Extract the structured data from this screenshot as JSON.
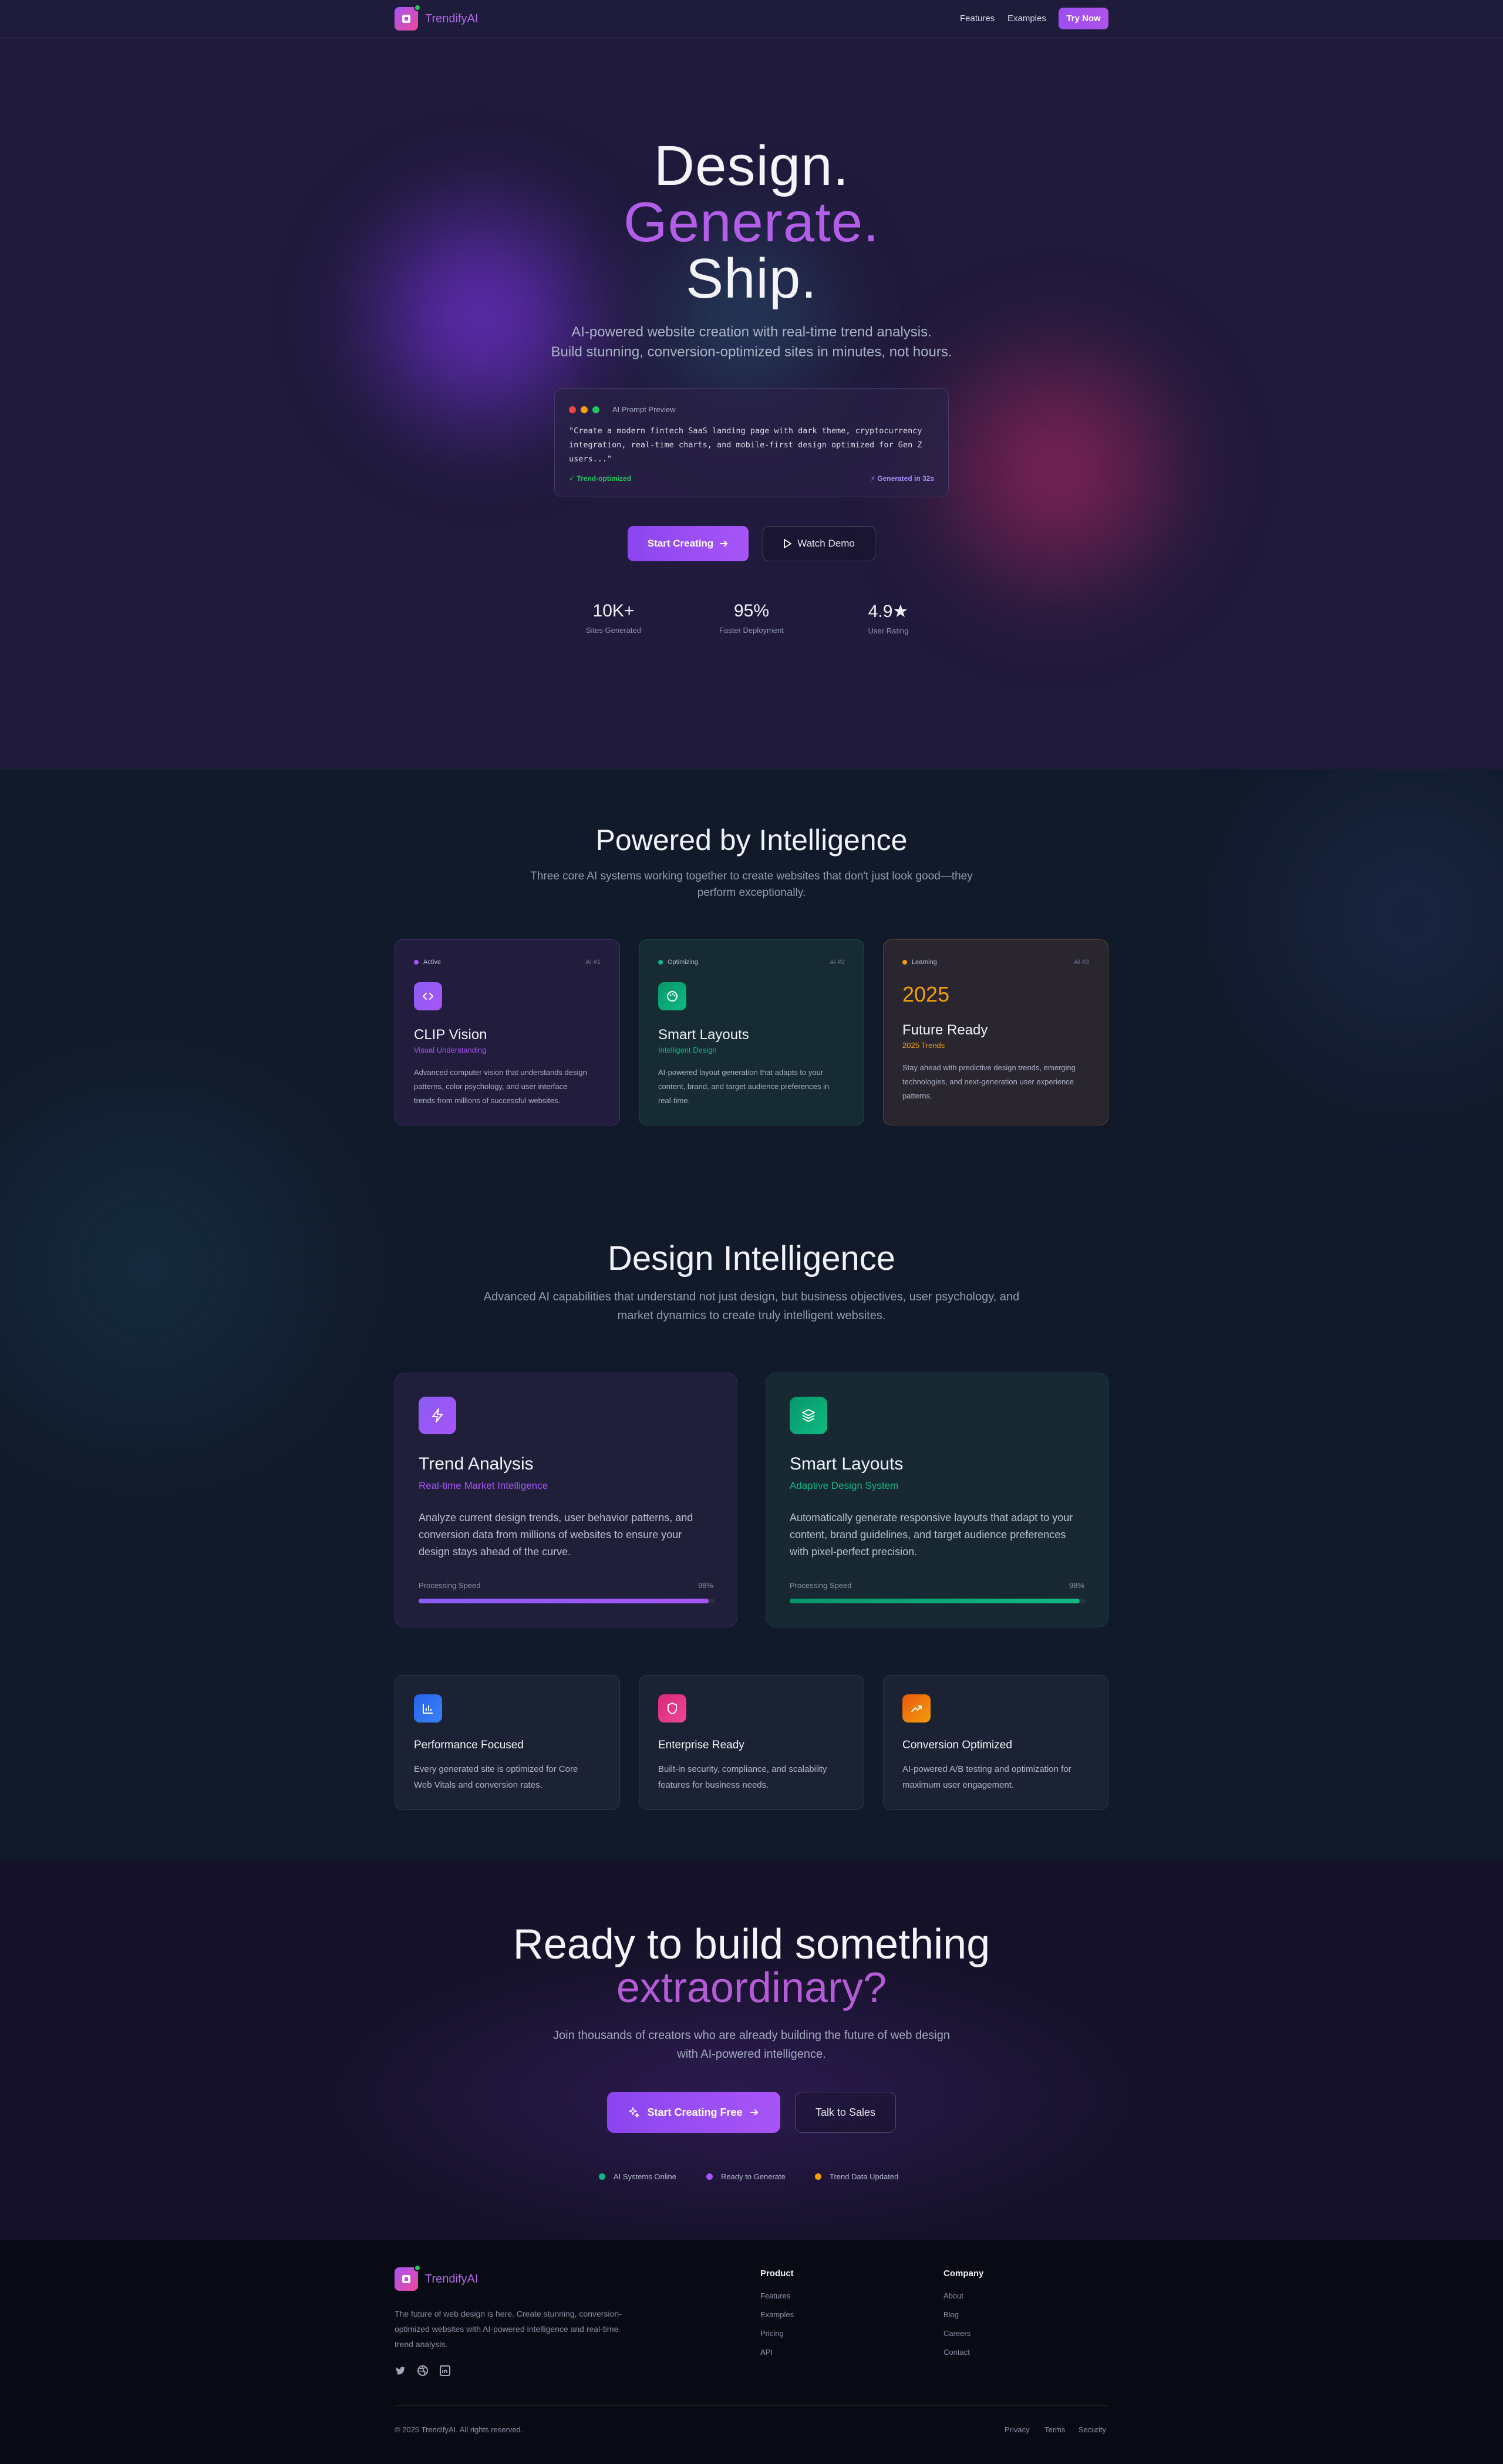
{
  "nav": {
    "brand": "TrendifyAI",
    "links": [
      "Features",
      "Examples"
    ],
    "cta": "Try Now"
  },
  "hero": {
    "title_line1": "Design.",
    "title_line2": "Generate.",
    "title_line3": "Ship.",
    "subtitle_line1": "AI-powered website creation with real-time trend analysis.",
    "subtitle_line2": "Build stunning, conversion-optimized sites in minutes, not hours.",
    "preview": {
      "label": "AI Prompt Preview",
      "prompt_line1": "\"Create a modern fintech SaaS landing page with dark theme, cryptocurrency",
      "prompt_line2": "integration, real-time charts, and mobile-first design optimized for Gen Z",
      "prompt_line3": "users...\"",
      "status_left": "✓ Trend-optimized",
      "status_right": "⚡ Generated in 32s"
    },
    "primary_cta": "Start Creating",
    "secondary_cta": "Watch Demo",
    "stats": [
      {
        "value": "10K+",
        "label": "Sites Generated"
      },
      {
        "value": "95%",
        "label": "Faster Deployment"
      },
      {
        "value": "4.9★",
        "label": "User Rating"
      }
    ]
  },
  "intelligence": {
    "title": "Powered by Intelligence",
    "subtitle_line1": "Three core AI systems working together to create websites that don't just look good—they",
    "subtitle_line2": "perform exceptionally.",
    "cards": [
      {
        "status": "Active",
        "tag": "AI #1",
        "name": "CLIP Vision",
        "subtitle": "Visual Understanding",
        "desc_line1": "Advanced computer vision that understands design",
        "desc_line2": "patterns, color psychology, and user interface",
        "desc_line3": "trends from millions of successful websites."
      },
      {
        "status": "Optimizing",
        "tag": "AI #2",
        "name": "Smart Layouts",
        "subtitle": "Intelligent Design",
        "desc_line1": "AI-powered layout generation that adapts to your",
        "desc_line2": "content, brand, and target audience preferences in",
        "desc_line3": "real-time."
      },
      {
        "status": "Learning",
        "tag": "AI #3",
        "year": "2025",
        "name": "Future Ready",
        "subtitle": "2025 Trends",
        "desc_line1": "Stay ahead with predictive design trends, emerging",
        "desc_line2": "technologies, and next-generation user experience",
        "desc_line3": "patterns."
      }
    ]
  },
  "design": {
    "title": "Design Intelligence",
    "subtitle_line1": "Advanced AI capabilities that understand not just design, but business objectives, user psychology, and",
    "subtitle_line2": "market dynamics to create truly intelligent websites.",
    "big_cards": [
      {
        "name": "Trend Analysis",
        "subtitle": "Real-time Market Intelligence",
        "desc_line1": "Analyze current design trends, user behavior patterns, and",
        "desc_line2": "conversion data from millions of websites to ensure your",
        "desc_line3": "design stays ahead of the curve.",
        "meter_label": "Processing Speed",
        "meter_value": "98%",
        "meter_fraction": 0.98,
        "color": "#a855f7"
      },
      {
        "name": "Smart Layouts",
        "subtitle": "Adaptive Design System",
        "desc_line1": "Automatically generate responsive layouts that adapt to your",
        "desc_line2": "content, brand guidelines, and target audience preferences",
        "desc_line3": "with pixel-perfect precision.",
        "meter_label": "Processing Speed",
        "meter_value": "98%",
        "meter_fraction": 0.98,
        "color": "#10b981"
      }
    ],
    "small_cards": [
      {
        "name": "Performance Focused",
        "desc_line1": "Every generated site is optimized for Core",
        "desc_line2": "Web Vitals and conversion rates."
      },
      {
        "name": "Enterprise Ready",
        "desc_line1": "Built-in security, compliance, and scalability",
        "desc_line2": "features for business needs."
      },
      {
        "name": "Conversion Optimized",
        "desc_line1": "AI-powered A/B testing and optimization for",
        "desc_line2": "maximum user engagement."
      }
    ]
  },
  "cta": {
    "title_line1": "Ready to build something",
    "title_line2": "extraordinary?",
    "subtitle_line1": "Join thousands of creators who are already building the future of web design",
    "subtitle_line2": "with AI-powered intelligence.",
    "primary": "Start Creating Free",
    "secondary": "Talk to Sales",
    "statuses": [
      "AI Systems Online",
      "Ready to Generate",
      "Trend Data Updated"
    ]
  },
  "footer": {
    "brand": "TrendifyAI",
    "desc_line1": "The future of web design is here. Create stunning, conversion-",
    "desc_line2": "optimized websites with AI-powered intelligence and real-time",
    "desc_line3": "trend analysis.",
    "product_heading": "Product",
    "product_links": [
      "Features",
      "Examples",
      "Pricing",
      "API"
    ],
    "company_heading": "Company",
    "company_links": [
      "About",
      "Blog",
      "Careers",
      "Contact"
    ],
    "copyright": "© 2025 TrendifyAI. All rights reserved.",
    "legal_links": [
      "Privacy",
      "Terms",
      "Security"
    ]
  },
  "colors": {
    "purple": "#a855f7",
    "pink": "#ec4899",
    "emerald": "#10b981",
    "amber": "#f59e0b",
    "blue": "#3b82f6"
  }
}
